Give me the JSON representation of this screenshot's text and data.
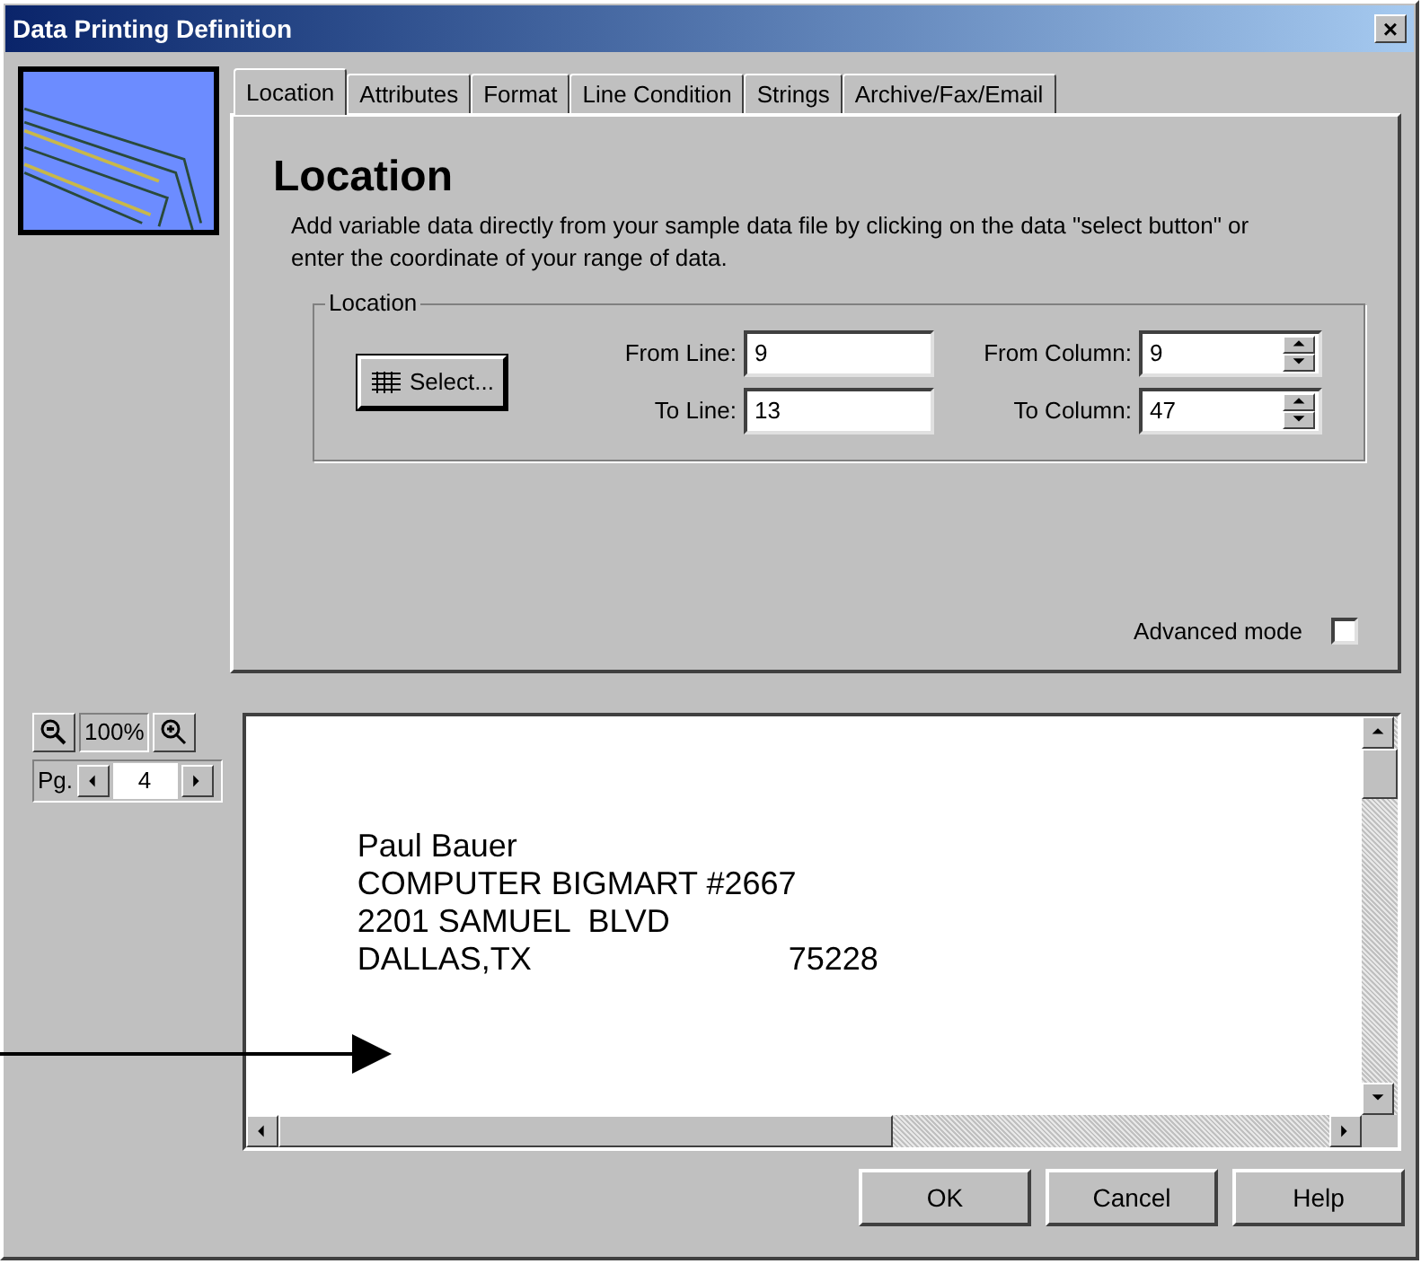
{
  "window": {
    "title": "Data Printing Definition",
    "close": "×"
  },
  "tabs": [
    {
      "label": "Location",
      "selected": true
    },
    {
      "label": "Attributes",
      "selected": false
    },
    {
      "label": "Format",
      "selected": false
    },
    {
      "label": "Line Condition",
      "selected": false
    },
    {
      "label": "Strings",
      "selected": false
    },
    {
      "label": "Archive/Fax/Email",
      "selected": false
    }
  ],
  "panel": {
    "heading": "Location",
    "description": "Add variable data directly from your sample data file by clicking on the data \"select button\" or enter the coordinate of your range of data.",
    "group": {
      "title": "Location",
      "select_button": "Select...",
      "fields": [
        {
          "label": "From Line:",
          "value": "9",
          "kind": "text"
        },
        {
          "label": "From Column:",
          "value": "9",
          "kind": "spin"
        },
        {
          "label": "To Line:",
          "value": "13",
          "kind": "text"
        },
        {
          "label": "To Column:",
          "value": "47",
          "kind": "spin"
        }
      ]
    },
    "advanced_mode": {
      "label": "Advanced mode",
      "checked": false
    }
  },
  "preview_controls": {
    "zoom": "100%",
    "page_label": "Pg.",
    "page": "4"
  },
  "preview": {
    "lines": [
      [
        "Paul Bauer"
      ],
      [
        "COMPUTER BIGMART #2667"
      ],
      [
        "2201 SAMUEL  BLVD"
      ],
      [
        "DALLAS,TX",
        "75228"
      ]
    ]
  },
  "buttons": [
    "OK",
    "Cancel",
    "Help"
  ]
}
